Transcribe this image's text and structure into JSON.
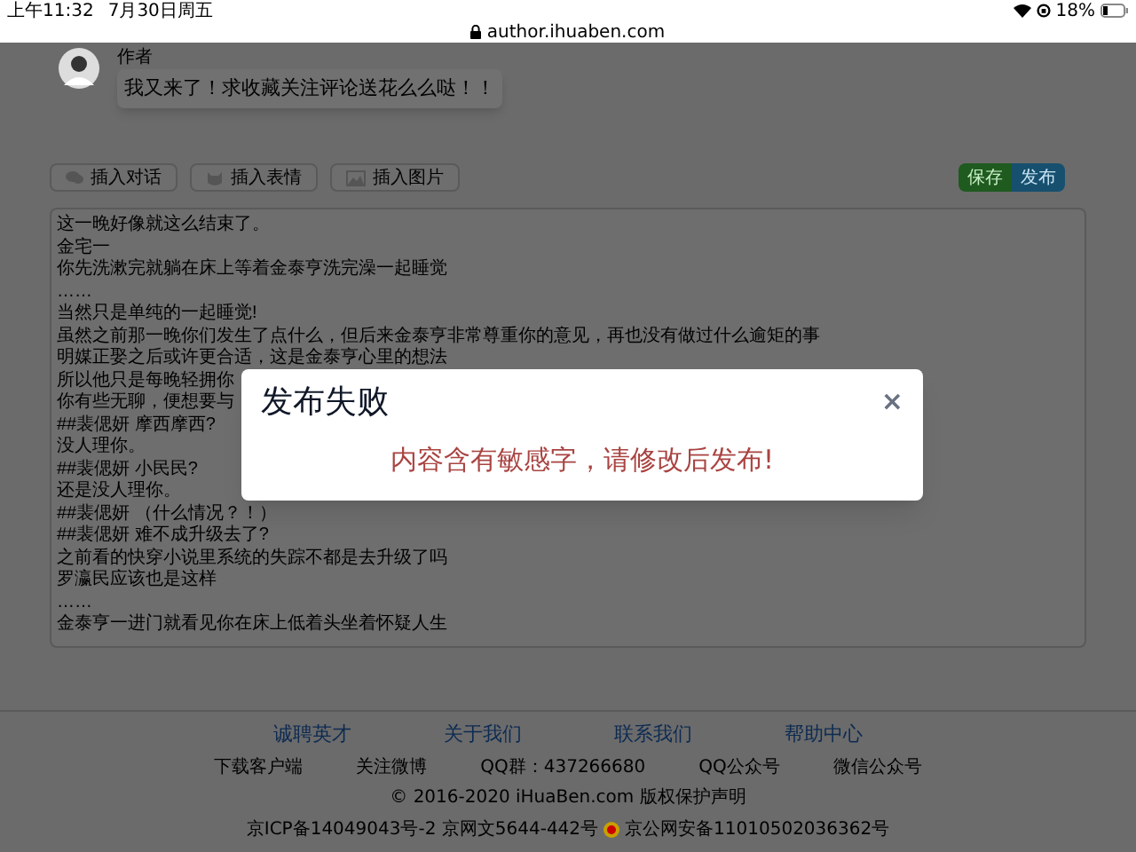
{
  "status_bar": {
    "time": "上午11:32",
    "date": "7月30日周五",
    "battery": "18%"
  },
  "address_bar": {
    "url": "author.ihuaben.com"
  },
  "author_bubble": {
    "role": "作者",
    "message": "我又来了！求收藏关注评论送花么么哒！！"
  },
  "toolbar": {
    "insert_buttons": [
      "插入对话",
      "插入表情",
      "插入图片"
    ],
    "save": "保存",
    "publish": "发布"
  },
  "editor": {
    "lines": [
      "这一晚好像就这么结束了。",
      "金宅一",
      "你先洗漱完就躺在床上等着金泰亨洗完澡一起睡觉",
      "……",
      "当然只是单纯的一起睡觉!",
      "虽然之前那一晚你们发生了点什么，但后来金泰亨非常尊重你的意见，再也没有做过什么逾矩的事",
      "明媒正娶之后或许更合适，这是金泰亨心里的想法",
      "所以他只是每晚轻拥你",
      "你有些无聊，便想要与",
      "##裴偲妍 摩西摩西?",
      "没人理你。",
      "##裴偲妍 小民民?",
      "还是没人理你。",
      "##裴偲妍 （什么情况？！）",
      "##裴偲妍 难不成升级去了?",
      "之前看的快穿小说里系统的失踪不都是去升级了吗",
      "罗瀛民应该也是这样",
      "……",
      "金泰亨一进门就看见你在床上低着头坐着怀疑人生"
    ]
  },
  "footer": {
    "links": [
      "诚聘英才",
      "关于我们",
      "联系我们",
      "帮助中心"
    ],
    "items": [
      "下载客户端",
      "关注微博",
      "QQ群：437266680",
      "QQ公众号",
      "微信公众号"
    ],
    "copyright": "© 2016-2020 iHuaBen.com 版权保护声明",
    "icp": "京ICP备14049043号-2 京网文5644-442号",
    "police": "京公网安备11010502036362号"
  },
  "dialog": {
    "title": "发布失败",
    "close": "×",
    "message": "内容含有敏感字，请修改后发布!"
  }
}
